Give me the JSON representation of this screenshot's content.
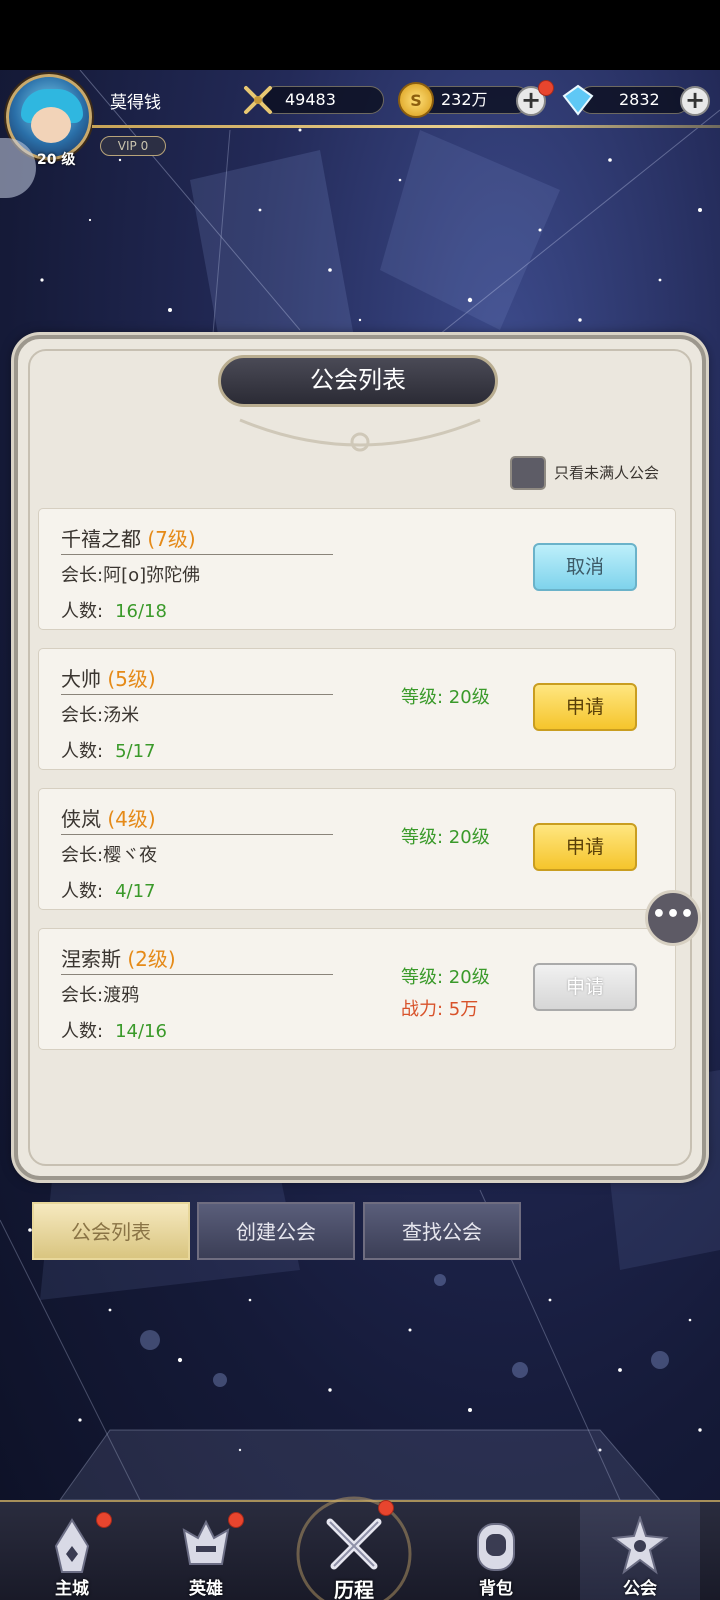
{
  "player": {
    "name": "莫得钱",
    "level": "20 级",
    "vip": "VIP   0"
  },
  "resources": {
    "power": "49483",
    "gold": "232万",
    "gems": "2832"
  },
  "panel": {
    "title": "公会列表",
    "filter_label": "只看未满人公会"
  },
  "guilds": [
    {
      "name": "千禧之都",
      "level": "(7级)",
      "leader_label": "会长:",
      "leader": "阿[o]弥陀佛",
      "members_label": "人数:",
      "members": "16/18",
      "req_level": "",
      "req_power": "",
      "action": "取消",
      "action_state": "cancel"
    },
    {
      "name": "大帅",
      "level": "(5级)",
      "leader_label": "会长:",
      "leader": "汤米",
      "members_label": "人数:",
      "members": "5/17",
      "req_level": "等级: 20级",
      "req_power": "",
      "action": "申请",
      "action_state": "apply"
    },
    {
      "name": "侠岚",
      "level": "(4级)",
      "leader_label": "会长:",
      "leader": "樱ヾ夜",
      "members_label": "人数:",
      "members": "4/17",
      "req_level": "等级: 20级",
      "req_power": "",
      "action": "申请",
      "action_state": "apply"
    },
    {
      "name": "涅索斯",
      "level": "(2级)",
      "leader_label": "会长:",
      "leader": "渡鸦",
      "members_label": "人数:",
      "members": "14/16",
      "req_level": "等级: 20级",
      "req_power": "战力: 5万",
      "action": "申请",
      "action_state": "disabled"
    }
  ],
  "tabs": [
    {
      "label": "公会列表",
      "active": true
    },
    {
      "label": "创建公会",
      "active": false
    },
    {
      "label": "查找公会",
      "active": false
    }
  ],
  "nav": [
    {
      "label": "主城",
      "icon": "castle-icon",
      "badge": true
    },
    {
      "label": "英雄",
      "icon": "hero-helmet-icon",
      "badge": true
    },
    {
      "label": "历程",
      "icon": "crossed-swords-icon",
      "badge": true
    },
    {
      "label": "背包",
      "icon": "backpack-icon",
      "badge": false
    },
    {
      "label": "公会",
      "icon": "guild-crest-icon",
      "badge": false
    }
  ],
  "colors": {
    "accent_gold": "#c7a357",
    "apply_yellow": "#f5c52c",
    "cancel_cyan": "#7fd3ec",
    "green_text": "#3a9a2a",
    "orange_level": "#e58a18",
    "red_power": "#d8522a"
  }
}
